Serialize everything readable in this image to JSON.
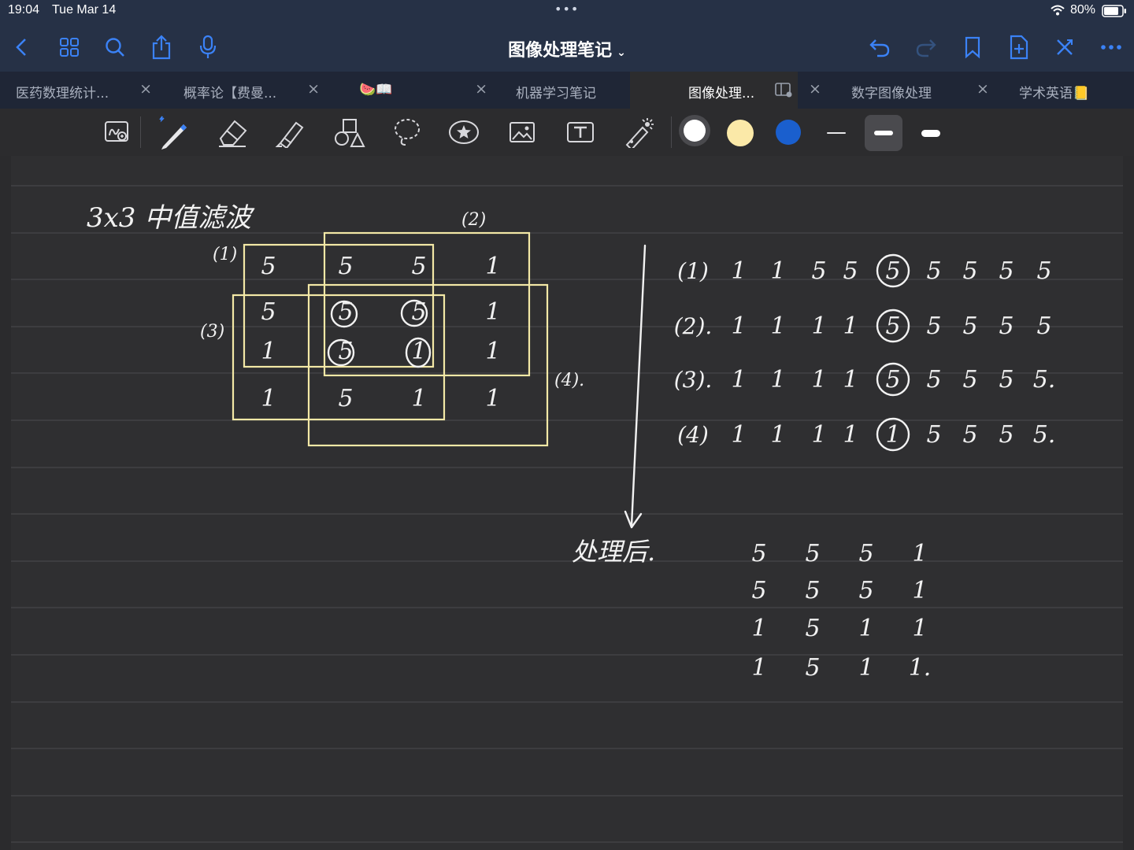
{
  "status": {
    "time": "19:04",
    "date": "Tue Mar 14",
    "dots": "•••",
    "battery": "80%"
  },
  "nav": {
    "title": "图像处理笔记",
    "left_icons": [
      "back-icon",
      "grid-icon",
      "search-icon",
      "share-icon",
      "microphone-icon"
    ],
    "right_icons": [
      "undo-icon",
      "redo-icon",
      "bookmark-icon",
      "add-page-icon",
      "close-icon",
      "more-icon"
    ]
  },
  "tabs": [
    {
      "label": "医药数理统计...",
      "active": false
    },
    {
      "label": "概率论【费曼...",
      "active": false
    },
    {
      "label": "🍉📖",
      "active": false
    },
    {
      "label": "机器学习笔记",
      "active": false
    },
    {
      "label": "图像处理...",
      "active": true
    },
    {
      "label": "数字图像处理",
      "active": false
    },
    {
      "label": "学术英语📒",
      "active": false
    }
  ],
  "toolbar": {
    "tools": [
      "zoom-window-icon",
      "pen-icon",
      "eraser-icon",
      "highlighter-icon",
      "shapes-icon",
      "lasso-icon",
      "sticker-icon",
      "image-icon",
      "text-icon",
      "laser-pointer-icon"
    ],
    "colors": [
      "#ffffff",
      "#fbe9a8",
      "#1a5fce"
    ],
    "thickness_selected": 2
  },
  "note": {
    "title": "3x3 中值滤波",
    "matrix": [
      [
        "5",
        "5",
        "5",
        "1"
      ],
      [
        "5",
        "5",
        "5",
        "1"
      ],
      [
        "1",
        "5",
        "1",
        "1"
      ],
      [
        "1",
        "5",
        "1",
        "1"
      ]
    ],
    "window_labels": [
      "(1)",
      "(2)",
      "(3)",
      "(4)."
    ],
    "sorted_rows": [
      {
        "label": "(1)",
        "values": [
          "1",
          "1",
          "5",
          "5",
          "5",
          "5",
          "5",
          "5",
          "5"
        ],
        "median": "5"
      },
      {
        "label": "(2).",
        "values": [
          "1",
          "1",
          "1",
          "1",
          "5",
          "5",
          "5",
          "5",
          "5"
        ],
        "median": "5"
      },
      {
        "label": "(3).",
        "values": [
          "1",
          "1",
          "1",
          "1",
          "5",
          "5",
          "5",
          "5",
          "5."
        ],
        "median": "5"
      },
      {
        "label": "(4)",
        "values": [
          "1",
          "1",
          "1",
          "1",
          "1",
          "5",
          "5",
          "5",
          "5."
        ],
        "median": "1"
      }
    ],
    "after_label": "处理后.",
    "result": [
      [
        "5",
        "5",
        "5",
        "1"
      ],
      [
        "5",
        "5",
        "5",
        "1"
      ],
      [
        "1",
        "5",
        "1",
        "1"
      ],
      [
        "1",
        "5",
        "1",
        "1."
      ]
    ]
  }
}
